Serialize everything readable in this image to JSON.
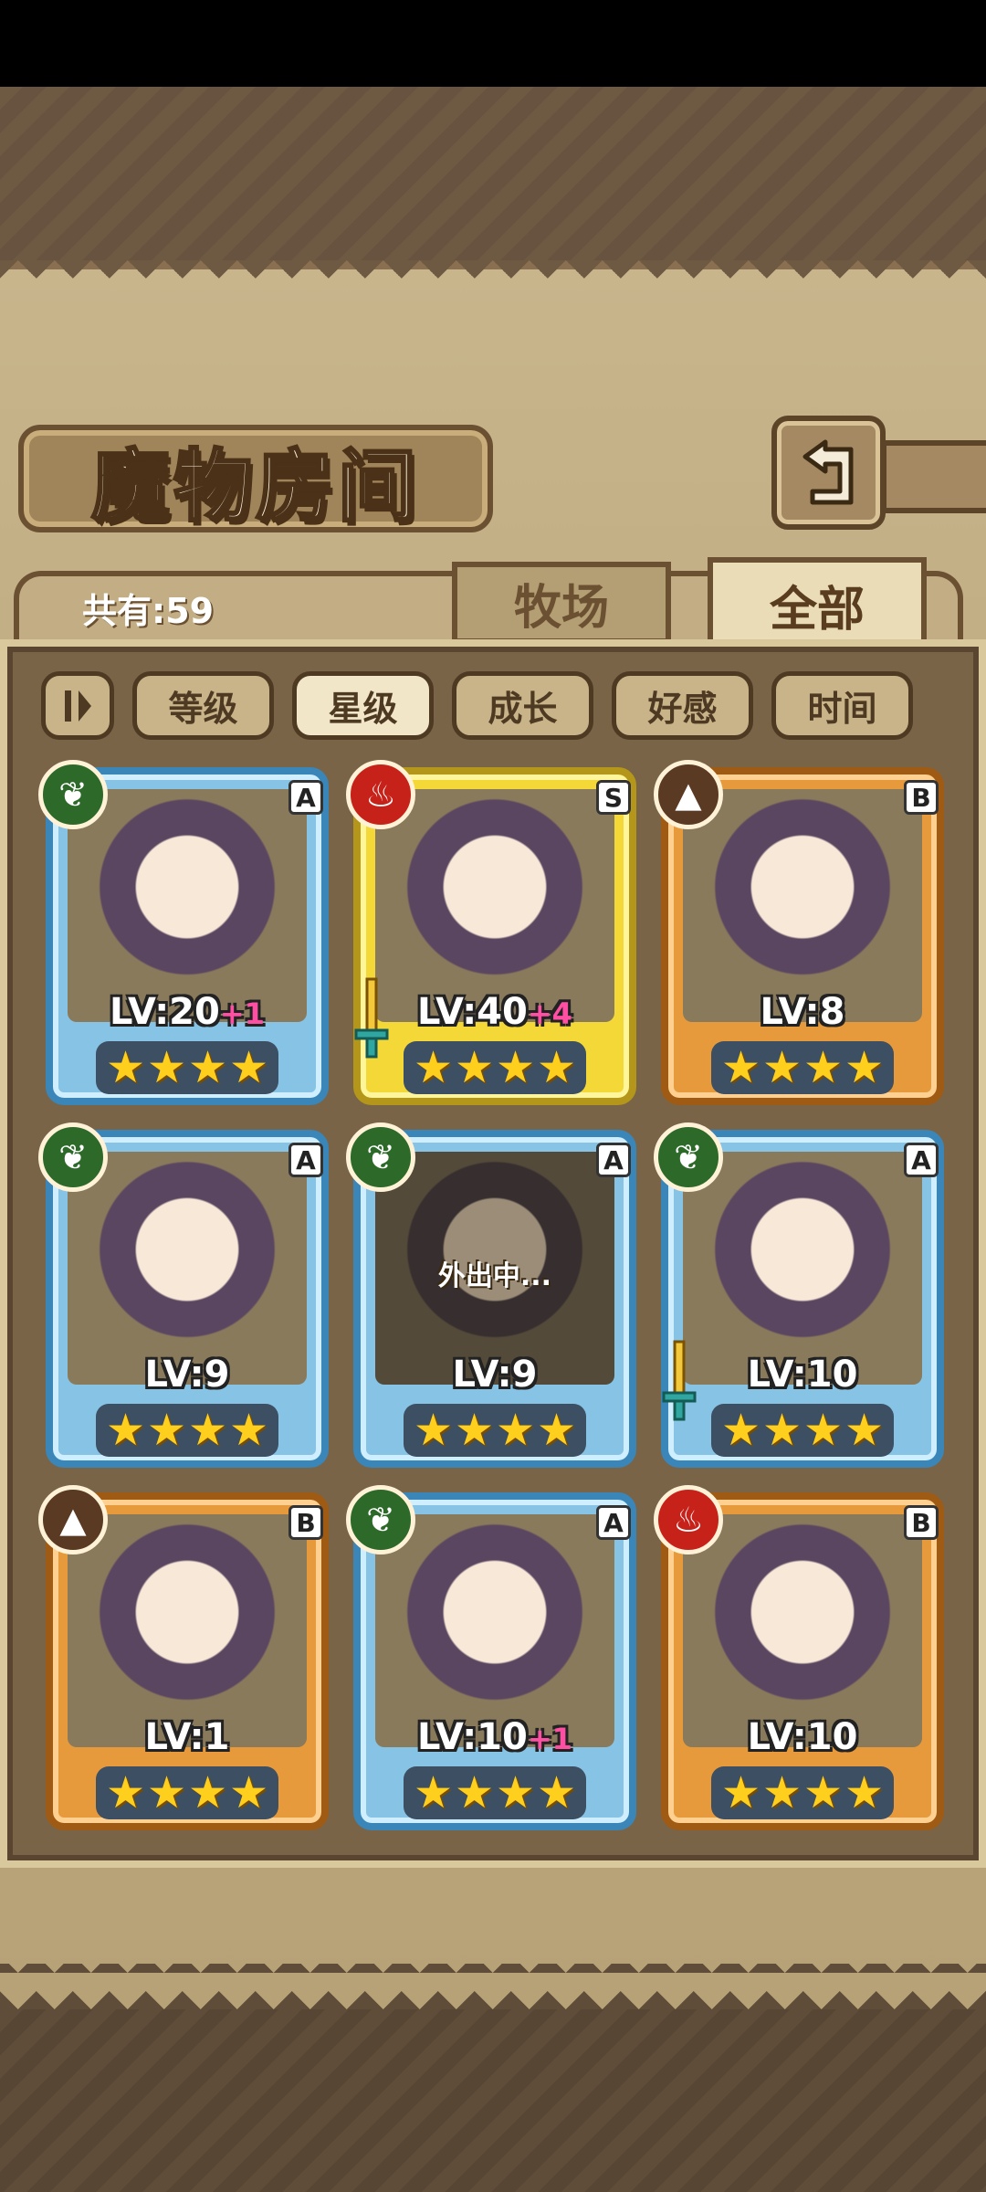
{
  "title": "魔物房间",
  "count_label": "共有:59",
  "tabs": {
    "farm": "牧场",
    "all": "全部"
  },
  "sort_buttons": [
    "等级",
    "星级",
    "成长",
    "好感",
    "时间"
  ],
  "active_sort": "星级",
  "cards": [
    {
      "element": "leaf",
      "rank": "A",
      "frame": "blue",
      "level": "LV:20",
      "bonus": "+1",
      "stars": 4,
      "equipped": false,
      "away": ""
    },
    {
      "element": "fire",
      "rank": "S",
      "frame": "gold",
      "level": "LV:40",
      "bonus": "+4",
      "stars": 4,
      "equipped": true,
      "away": ""
    },
    {
      "element": "earth",
      "rank": "B",
      "frame": "orange",
      "level": "LV:8",
      "bonus": "",
      "stars": 4,
      "equipped": false,
      "away": ""
    },
    {
      "element": "leaf",
      "rank": "A",
      "frame": "blue",
      "level": "LV:9",
      "bonus": "",
      "stars": 4,
      "equipped": false,
      "away": ""
    },
    {
      "element": "leaf",
      "rank": "A",
      "frame": "blue",
      "level": "LV:9",
      "bonus": "",
      "stars": 4,
      "equipped": false,
      "away": "外出中..."
    },
    {
      "element": "leaf",
      "rank": "A",
      "frame": "blue",
      "level": "LV:10",
      "bonus": "",
      "stars": 4,
      "equipped": true,
      "away": ""
    },
    {
      "element": "earth",
      "rank": "B",
      "frame": "orange",
      "level": "LV:1",
      "bonus": "",
      "stars": 4,
      "equipped": false,
      "away": ""
    },
    {
      "element": "leaf",
      "rank": "A",
      "frame": "blue",
      "level": "LV:10",
      "bonus": "+1",
      "stars": 4,
      "equipped": false,
      "away": ""
    },
    {
      "element": "fire",
      "rank": "B",
      "frame": "orange",
      "level": "LV:10",
      "bonus": "",
      "stars": 4,
      "equipped": false,
      "away": ""
    }
  ]
}
